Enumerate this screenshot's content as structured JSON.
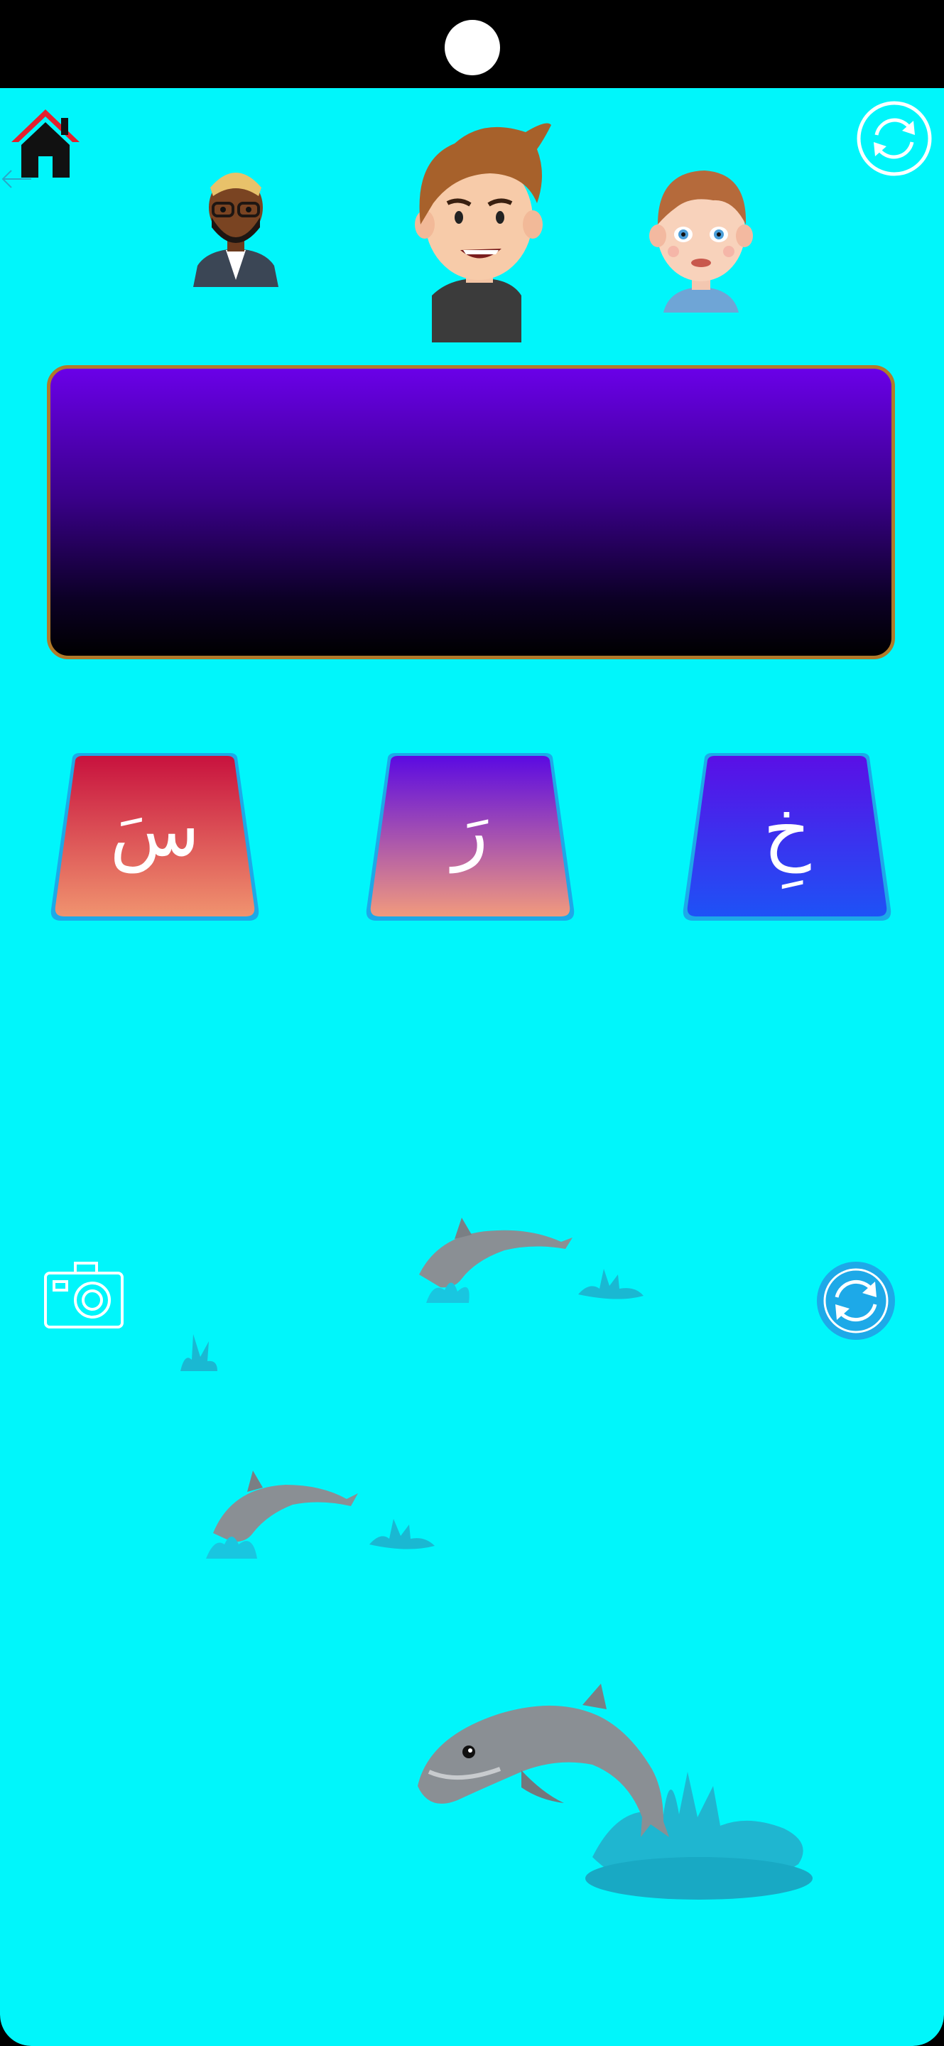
{
  "app": {
    "background": "#00f6fb",
    "accent": "#1da9e8",
    "home_roof_color": "#e41f2d"
  },
  "top_bar": {
    "home_icon": "home-icon",
    "back_icon": "arrow-left-icon",
    "refresh_icon": "refresh-icon"
  },
  "avatars": [
    {
      "id": "bearded-man",
      "icon": "avatar-bearded-man"
    },
    {
      "id": "young-man",
      "icon": "avatar-young-man"
    },
    {
      "id": "boy",
      "icon": "avatar-boy"
    }
  ],
  "display": {
    "text": ""
  },
  "letter_cards": [
    {
      "letter": "سَ",
      "gradient": [
        "#c8123e",
        "#f0936f"
      ]
    },
    {
      "letter": "رَ",
      "gradient": [
        "#5b0ae2",
        "#f19a7d"
      ]
    },
    {
      "letter": "خِ",
      "gradient": [
        "#5a0fe6",
        "#1e52f6"
      ]
    }
  ],
  "bottom_controls": {
    "camera_icon": "camera-icon",
    "refresh_icon": "refresh-icon"
  },
  "decorations": [
    "dolphin",
    "dolphin",
    "dolphin",
    "water-splash"
  ]
}
